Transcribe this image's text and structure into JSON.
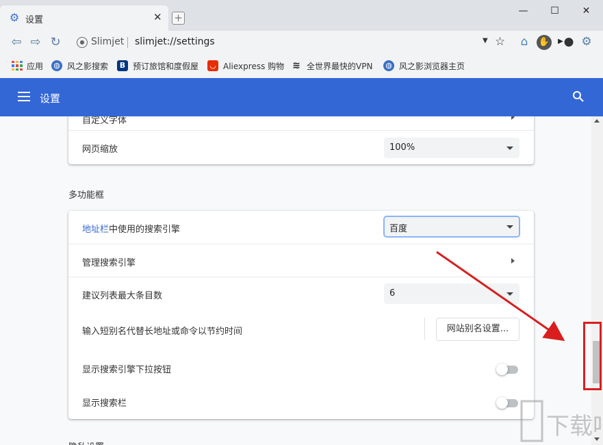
{
  "browser": {
    "tab_title": "设置",
    "site_name": "Slimjet",
    "url": "slimjet://settings",
    "window_controls": {
      "minimize": "—",
      "maximize": "☐",
      "close": "✕"
    }
  },
  "bookmarks": [
    {
      "label": "应用",
      "icon": "apps-grid-icon",
      "color": "#e8453c"
    },
    {
      "label": "风之影搜索",
      "icon": "globe-icon",
      "color": "#3a6fc4"
    },
    {
      "label": "预订旅馆和度假屋",
      "icon": "booking-b-icon",
      "color": "#003580"
    },
    {
      "label": "Aliexpress 购物",
      "icon": "aliexpress-icon",
      "color": "#e62e04"
    },
    {
      "label": "全世界最快的VPN",
      "icon": "vpn-icon",
      "color": "#222222"
    },
    {
      "label": "风之影浏览器主页",
      "icon": "globe-icon",
      "color": "#3a6fc4"
    }
  ],
  "appbar": {
    "title": "设置",
    "accent": "#3367d6"
  },
  "settings": {
    "top_card": {
      "partial_row_label": "自定义字体",
      "zoom_label": "网页缩放",
      "zoom_value": "100%"
    },
    "section_title": "多功能框",
    "omnibox_card": {
      "search_engine_label_link": "地址栏",
      "search_engine_label_rest": "中使用的搜索引擎",
      "search_engine_value": "百度",
      "manage_label": "管理搜索引擎",
      "max_suggestions_label": "建议列表最大条目数",
      "max_suggestions_value": "6",
      "alias_label": "输入短别名代替长地址或命令以节约时间",
      "alias_button": "网站别名设置...",
      "dropdown_btn_label": "显示搜索引擎下拉按钮",
      "dropdown_btn_enabled": false,
      "search_bar_label": "显示搜索栏",
      "search_bar_enabled": false
    },
    "next_section_partial": "隐私设置"
  },
  "annotation": {
    "color": "#d81e1e"
  },
  "watermark": {
    "text": "下载吧"
  }
}
